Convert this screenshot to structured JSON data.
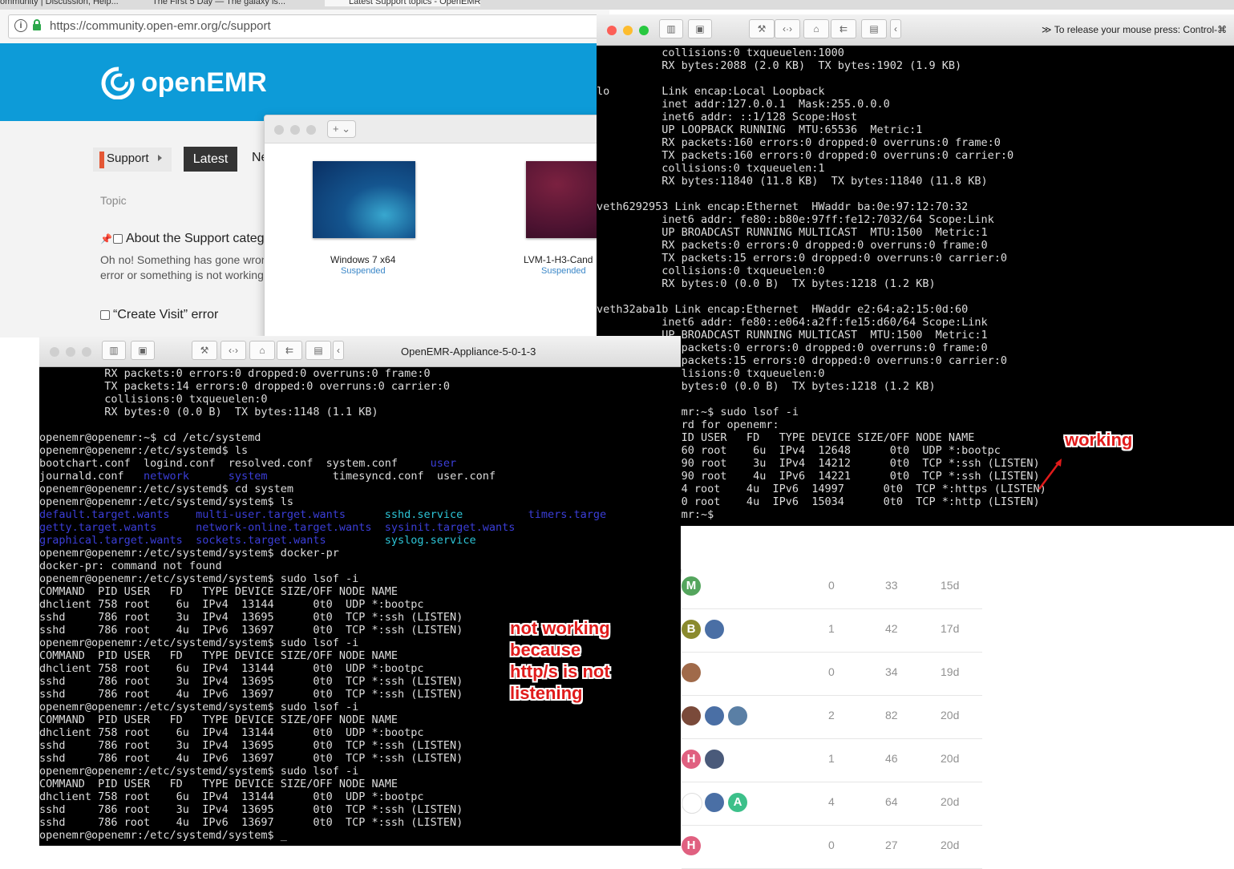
{
  "browser": {
    "tabs": [
      "ommunity | Discussion, Help...",
      "The First 5 Day — The galaxy is...",
      "Latest Support topics - OpenEMR"
    ],
    "url": "https://community.open-emr.org/c/support"
  },
  "site": {
    "logo_text": "openEMR",
    "nav": {
      "support": "Support",
      "latest": "Latest",
      "new": "Ne"
    },
    "topic_header": "Topic",
    "topic1": {
      "title": "About the Support categ",
      "excerpt_line1": "Oh no! Something has gone wron",
      "excerpt_line2": "error or something is not working"
    },
    "topic2": {
      "title": "“Create Visit” error"
    },
    "rows": [
      {
        "avatars": [
          {
            "letter": "M",
            "color": "#54a55d"
          }
        ],
        "replies": "0",
        "views": "33",
        "activity": "15d"
      },
      {
        "avatars": [
          {
            "letter": "B",
            "color": "#8a8a2e"
          },
          {
            "letter": "",
            "color": "#4a6fa5"
          }
        ],
        "replies": "1",
        "views": "42",
        "activity": "17d"
      },
      {
        "avatars": [
          {
            "letter": "",
            "color": "#a06a4a"
          }
        ],
        "replies": "0",
        "views": "34",
        "activity": "19d"
      },
      {
        "avatars": [
          {
            "letter": "",
            "color": "#7a4a3a"
          },
          {
            "letter": "",
            "color": "#4a6fa5"
          },
          {
            "letter": "",
            "color": "#5a7fa5"
          }
        ],
        "replies": "2",
        "views": "82",
        "activity": "20d"
      },
      {
        "avatars": [
          {
            "letter": "H",
            "color": "#e06080"
          },
          {
            "letter": "",
            "color": "#4a5a7a"
          }
        ],
        "replies": "1",
        "views": "46",
        "activity": "20d"
      },
      {
        "avatars": [
          {
            "letter": "",
            "color": "#ffffff"
          },
          {
            "letter": "",
            "color": "#4a6fa5"
          },
          {
            "letter": "A",
            "color": "#3cc08a"
          }
        ],
        "replies": "4",
        "views": "64",
        "activity": "20d"
      },
      {
        "avatars": [
          {
            "letter": "H",
            "color": "#e06080"
          }
        ],
        "replies": "0",
        "views": "27",
        "activity": "20d"
      }
    ]
  },
  "library": {
    "add_label": "+ ⌄",
    "vms": [
      {
        "name": "Windows 7 x64",
        "status": "Suspended"
      },
      {
        "name": "LVM-1-H3-Cand",
        "status": "Suspended"
      }
    ]
  },
  "vm_right": {
    "release_hint": "To release your mouse press: Control-⌘",
    "terminal_lines": [
      "          collisions:0 txqueuelen:1000",
      "          RX bytes:2088 (2.0 KB)  TX bytes:1902 (1.9 KB)",
      "",
      "lo        Link encap:Local Loopback",
      "          inet addr:127.0.0.1  Mask:255.0.0.0",
      "          inet6 addr: ::1/128 Scope:Host",
      "          UP LOOPBACK RUNNING  MTU:65536  Metric:1",
      "          RX packets:160 errors:0 dropped:0 overruns:0 frame:0",
      "          TX packets:160 errors:0 dropped:0 overruns:0 carrier:0",
      "          collisions:0 txqueuelen:1",
      "          RX bytes:11840 (11.8 KB)  TX bytes:11840 (11.8 KB)",
      "",
      "veth6292953 Link encap:Ethernet  HWaddr ba:0e:97:12:70:32",
      "          inet6 addr: fe80::b80e:97ff:fe12:7032/64 Scope:Link",
      "          UP BROADCAST RUNNING MULTICAST  MTU:1500  Metric:1",
      "          RX packets:0 errors:0 dropped:0 overruns:0 frame:0",
      "          TX packets:15 errors:0 dropped:0 overruns:0 carrier:0",
      "          collisions:0 txqueuelen:0",
      "          RX bytes:0 (0.0 B)  TX bytes:1218 (1.2 KB)",
      "",
      "veth32aba1b Link encap:Ethernet  HWaddr e2:64:a2:15:0d:60",
      "          inet6 addr: fe80::e064:a2ff:fe15:d60/64 Scope:Link",
      "          UP BROADCAST RUNNING MULTICAST  MTU:1500  Metric:1",
      "          RX packets:0 errors:0 dropped:0 overruns:0 frame:0",
      "          TX packets:15 errors:0 dropped:0 overruns:0 carrier:0",
      "          collisions:0 txqueuelen:0",
      "          RX bytes:0 (0.0 B)  TX bytes:1218 (1.2 KB)",
      "",
      "openemr@openemr:~$ sudo lsof -i",
      "[sudo] password for openemr:",
      "COMMAND     PID USER   FD   TYPE DEVICE SIZE/OFF NODE NAME",
      "dhclient    760 root    6u  IPv4  12648      0t0  UDP *:bootpc",
      "sshd        790 root    3u  IPv4  14212      0t0  TCP *:ssh (LISTEN)",
      "sshd        790 root    4u  IPv6  14221      0t0  TCP *:ssh (LISTEN)",
      "docker-pr 1034 root    4u  IPv6  14997      0t0  TCP *:https (LISTEN)",
      "docker-pr 1050 root    4u  IPv6  15034      0t0  TCP *:http (LISTEN)",
      "openemr@openemr:~$"
    ]
  },
  "vm_left": {
    "title": "OpenEMR-Appliance-5-0-1-3",
    "terminal_lines_top": [
      "          RX packets:0 errors:0 dropped:0 overruns:0 frame:0",
      "          TX packets:14 errors:0 dropped:0 overruns:0 carrier:0",
      "          collisions:0 txqueuelen:0",
      "          RX bytes:0 (0.0 B)  TX bytes:1148 (1.1 KB)",
      "",
      "openemr@openemr:~$ cd /etc/systemd",
      "openemr@openemr:/etc/systemd$ ls"
    ],
    "ls1": [
      [
        "bootchart.conf  logind.conf  resolved.conf  system.conf     ",
        "user",
        ""
      ],
      [
        "journald.conf   ",
        "network",
        "      ",
        "system",
        "          timesyncd.conf  user.conf"
      ]
    ],
    "cd_line": "openemr@openemr:/etc/systemd$ cd system",
    "ls_line": "openemr@openemr:/etc/systemd/system$ ls",
    "ls2": [
      [
        "default.target.wants",
        "multi-user.target.wants",
        "sshd.service",
        "timers.targe"
      ],
      [
        "getty.target.wants",
        "network-online.target.wants",
        "sysinit.target.wants",
        ""
      ],
      [
        "graphical.target.wants",
        "sockets.target.wants",
        "syslog.service",
        ""
      ]
    ],
    "terminal_lines_bottom": [
      "openemr@openemr:/etc/systemd/system$ docker-pr",
      "docker-pr: command not found",
      "openemr@openemr:/etc/systemd/system$ sudo lsof -i",
      "COMMAND  PID USER   FD   TYPE DEVICE SIZE/OFF NODE NAME",
      "dhclient 758 root    6u  IPv4  13144      0t0  UDP *:bootpc",
      "sshd     786 root    3u  IPv4  13695      0t0  TCP *:ssh (LISTEN)",
      "sshd     786 root    4u  IPv6  13697      0t0  TCP *:ssh (LISTEN)",
      "openemr@openemr:/etc/systemd/system$ sudo lsof -i",
      "COMMAND  PID USER   FD   TYPE DEVICE SIZE/OFF NODE NAME",
      "dhclient 758 root    6u  IPv4  13144      0t0  UDP *:bootpc",
      "sshd     786 root    3u  IPv4  13695      0t0  TCP *:ssh (LISTEN)",
      "sshd     786 root    4u  IPv6  13697      0t0  TCP *:ssh (LISTEN)",
      "openemr@openemr:/etc/systemd/system$ sudo lsof -i",
      "COMMAND  PID USER   FD   TYPE DEVICE SIZE/OFF NODE NAME",
      "dhclient 758 root    6u  IPv4  13144      0t0  UDP *:bootpc",
      "sshd     786 root    3u  IPv4  13695      0t0  TCP *:ssh (LISTEN)",
      "sshd     786 root    4u  IPv6  13697      0t0  TCP *:ssh (LISTEN)",
      "openemr@openemr:/etc/systemd/system$ sudo lsof -i",
      "COMMAND  PID USER   FD   TYPE DEVICE SIZE/OFF NODE NAME",
      "dhclient 758 root    6u  IPv4  13144      0t0  UDP *:bootpc",
      "sshd     786 root    3u  IPv4  13695      0t0  TCP *:ssh (LISTEN)",
      "sshd     786 root    4u  IPv6  13697      0t0  TCP *:ssh (LISTEN)",
      "openemr@openemr:/etc/systemd/system$ _"
    ]
  },
  "annotations": {
    "working": "working",
    "not_working": [
      "not working",
      "because",
      "http/s is not",
      "listening"
    ]
  },
  "colors": {
    "header_blue": "#0d9bd8",
    "annotation_red": "#e01b1b",
    "dir_blue": "#3b3ed8",
    "service_cyan": "#2dc4d6"
  }
}
